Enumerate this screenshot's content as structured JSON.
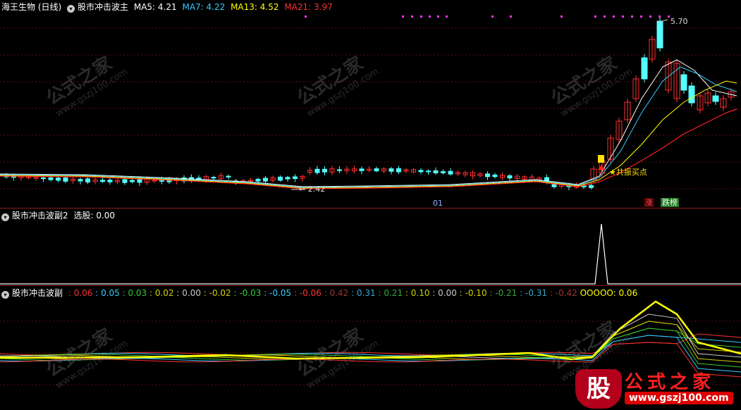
{
  "main": {
    "stock_name": "海王生物 (日线)",
    "indicator": "股市冲击波主",
    "ma": [
      {
        "label": "MA5: 4.21",
        "color": "#ffffff"
      },
      {
        "label": "MA7: 4.22",
        "color": "#33ccff"
      },
      {
        "label": "MA13: 4.52",
        "color": "#ffff00"
      },
      {
        "label": "MA21: 3.97",
        "color": "#ff3030"
      }
    ],
    "high_label": "5.70",
    "low_label": "2.42",
    "resonance_label": "共振买点",
    "badge_zhang": "涨",
    "badge_diebang": "跌榜",
    "marker_small": "01",
    "colors": {
      "up": "#ff3030",
      "down": "#54ffff",
      "bg": "#000000"
    }
  },
  "sub1": {
    "indicator": "股市冲击波副2",
    "value_text": "选股: 0.00"
  },
  "sub2": {
    "indicator": "股市冲击波副",
    "values": [
      {
        "text": ": 0.06",
        "color": "#ff3030"
      },
      {
        "text": ": 0.05",
        "color": "#33ccff"
      },
      {
        "text": ": 0.03",
        "color": "#33cc33"
      },
      {
        "text": ": 0.02",
        "color": "#d0d000"
      },
      {
        "text": ": 0.00",
        "color": "#c8c8c8"
      },
      {
        "text": ": -0.02",
        "color": "#d0d000"
      },
      {
        "text": ": -0.03",
        "color": "#33cc33"
      },
      {
        "text": ": -0.05",
        "color": "#33ccff"
      },
      {
        "text": ": -0.06",
        "color": "#ff3030"
      },
      {
        "text": ": 0.42",
        "color": "#a03030"
      },
      {
        "text": ": 0.31",
        "color": "#33aacc"
      },
      {
        "text": ": 0.21",
        "color": "#33aa33"
      },
      {
        "text": ": 0.10",
        "color": "#d0d000"
      },
      {
        "text": ": 0.00",
        "color": "#c8c8c8"
      },
      {
        "text": ": -0.10",
        "color": "#d0d000"
      },
      {
        "text": ": -0.21",
        "color": "#33aa33"
      },
      {
        "text": ": -0.31",
        "color": "#33aacc"
      },
      {
        "text": ": -0.42",
        "color": "#a03030"
      },
      {
        "text": "OOOOO: 0.06",
        "color": "#ffff00"
      }
    ]
  },
  "watermark": {
    "cn": "公式之家",
    "url": "www.gszj100.com"
  },
  "logo": {
    "glyph": "股",
    "name": "公式之家",
    "url": "www.gszj100.com"
  }
}
